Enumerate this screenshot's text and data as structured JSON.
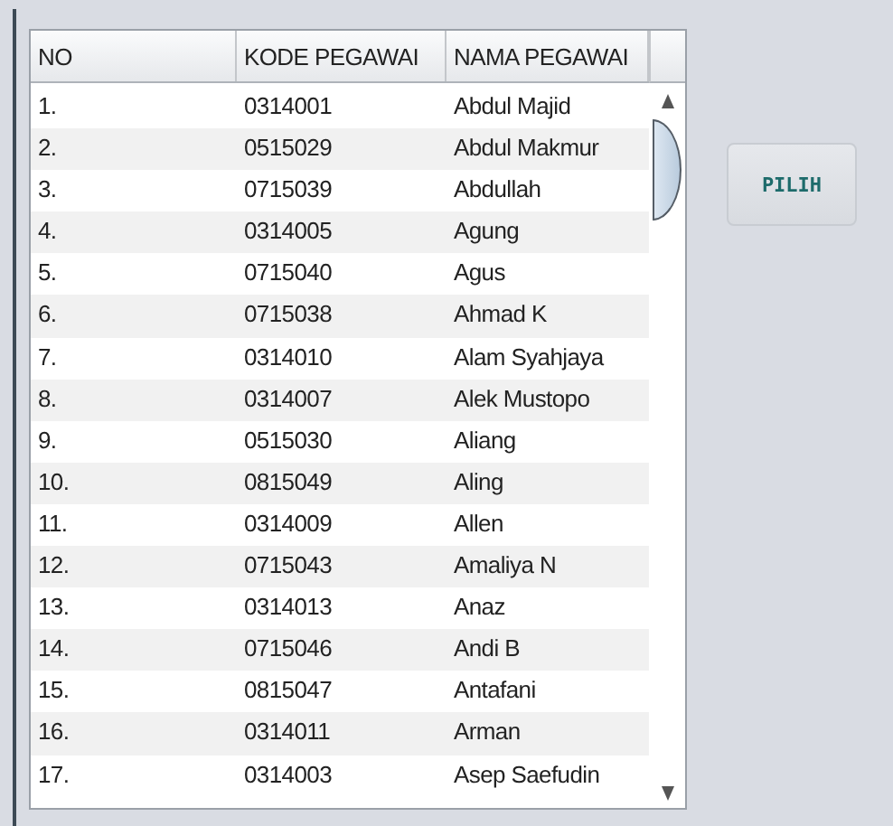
{
  "table": {
    "columns": [
      "NO",
      "KODE PEGAWAI",
      "NAMA PEGAWAI"
    ],
    "rows": [
      [
        "1.",
        "0314001",
        "Abdul Majid"
      ],
      [
        "2.",
        "0515029",
        "Abdul Makmur"
      ],
      [
        "3.",
        "0715039",
        "Abdullah"
      ],
      [
        "4.",
        "0314005",
        "Agung"
      ],
      [
        "5.",
        "0715040",
        "Agus"
      ],
      [
        "6.",
        "0715038",
        "Ahmad K"
      ],
      [
        "7.",
        "0314010",
        "Alam Syahjaya"
      ],
      [
        "8.",
        "0314007",
        "Alek Mustopo"
      ],
      [
        "9.",
        "0515030",
        "Aliang"
      ],
      [
        "10.",
        "0815049",
        "Aling"
      ],
      [
        "11.",
        "0314009",
        "Allen"
      ],
      [
        "12.",
        "0715043",
        "Amaliya N"
      ],
      [
        "13.",
        "0314013",
        "Anaz"
      ],
      [
        "14.",
        "0715046",
        "Andi B"
      ],
      [
        "15.",
        "0815047",
        "Antafani"
      ],
      [
        "16.",
        "0314011",
        "Arman"
      ],
      [
        "17.",
        "0314003",
        "Asep Saefudin"
      ]
    ]
  },
  "button": {
    "label": "PILIH"
  }
}
